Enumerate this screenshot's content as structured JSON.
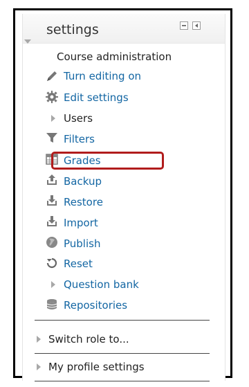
{
  "block": {
    "title": "settings"
  },
  "course_admin": {
    "label": "Course administration",
    "items": [
      {
        "label": "Turn editing on",
        "icon": "pencil-icon"
      },
      {
        "label": "Edit settings",
        "icon": "gear-icon"
      },
      {
        "label": "Users",
        "icon": "expand-arrow-icon"
      },
      {
        "label": "Filters",
        "icon": "filter-icon"
      },
      {
        "label": "Grades",
        "icon": "grades-table-icon"
      },
      {
        "label": "Backup",
        "icon": "backup-icon"
      },
      {
        "label": "Restore",
        "icon": "restore-icon"
      },
      {
        "label": "Import",
        "icon": "import-icon"
      },
      {
        "label": "Publish",
        "icon": "globe-icon"
      },
      {
        "label": "Reset",
        "icon": "reset-icon"
      },
      {
        "label": "Question bank",
        "icon": "expand-arrow-icon"
      },
      {
        "label": "Repositories",
        "icon": "database-icon"
      }
    ]
  },
  "sections": [
    {
      "label": "Switch role to..."
    },
    {
      "label": "My profile settings"
    }
  ],
  "colors": {
    "link": "#1366a3",
    "highlight_border": "#b11c1c"
  }
}
